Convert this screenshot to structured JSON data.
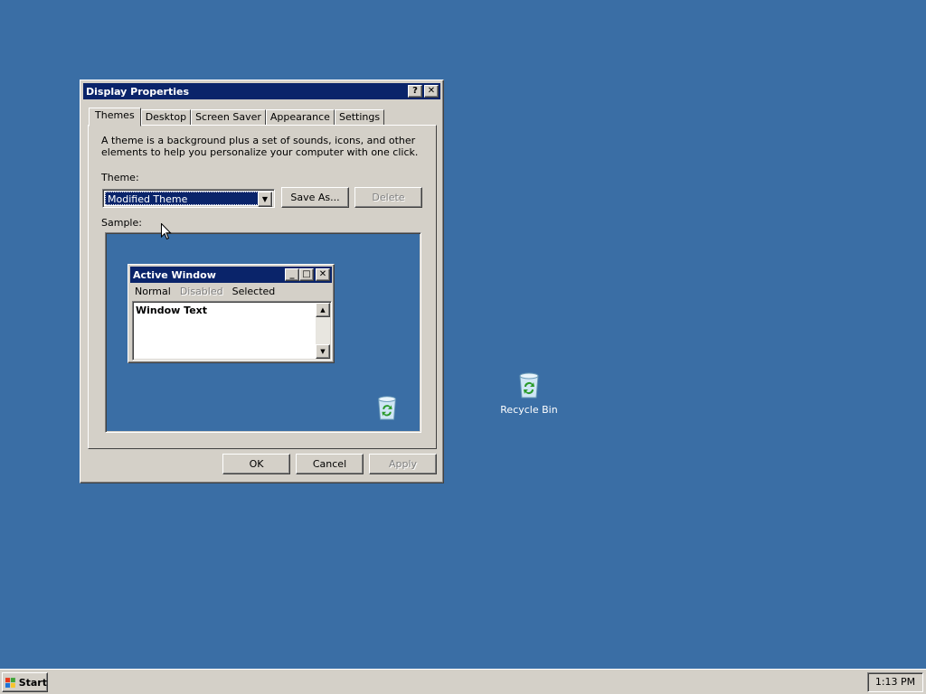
{
  "dialog": {
    "title": "Display Properties",
    "help_btn": "?",
    "close_btn": "✕",
    "tabs": [
      "Themes",
      "Desktop",
      "Screen Saver",
      "Appearance",
      "Settings"
    ],
    "active_tab": "Themes",
    "description": "A theme is a background plus a set of sounds, icons, and other elements to help you personalize your computer with one click.",
    "theme_label": "Theme:",
    "theme_value": "Modified Theme",
    "save_as": "Save As...",
    "delete": "Delete",
    "sample_label": "Sample:",
    "ok": "OK",
    "cancel": "Cancel",
    "apply": "Apply"
  },
  "sample_window": {
    "title": "Active Window",
    "menu": [
      "Normal",
      "Disabled",
      "Selected"
    ],
    "text": "Window Text"
  },
  "desktop": {
    "recycle_bin": "Recycle Bin",
    "background_color": "#3a6ea5"
  },
  "taskbar": {
    "start": "Start",
    "clock": "1:13 PM"
  }
}
